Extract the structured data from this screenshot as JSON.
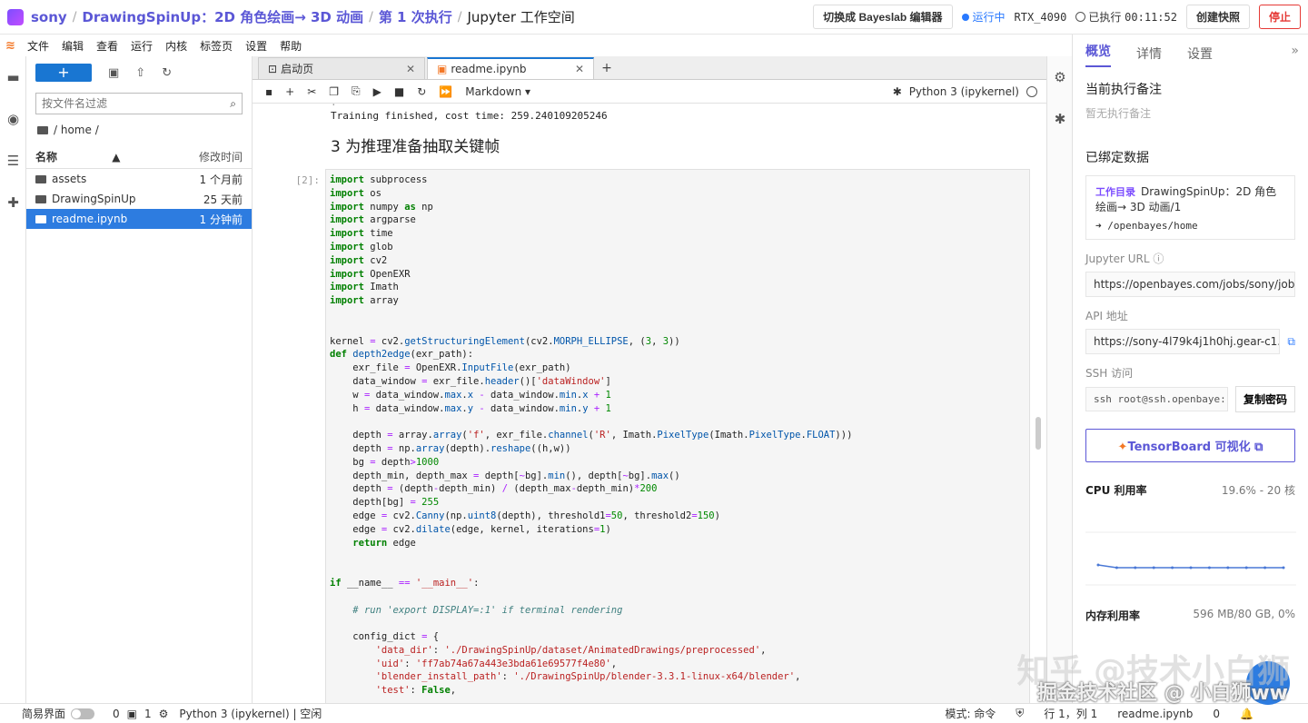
{
  "topbar": {
    "crumbs": [
      "sony",
      "DrawingSpinUp：2D 角色绘画→ 3D 动画",
      "第 1 次执行",
      "Jupyter 工作空间"
    ],
    "switch_label": "切换成 Bayeslab 编辑器",
    "status": "运行中",
    "gpu": "RTX_4090",
    "elapsed_label": "已执行",
    "elapsed_time": "00:11:52",
    "snapshot_label": "创建快照",
    "stop_label": "停止"
  },
  "menu": [
    "文件",
    "编辑",
    "查看",
    "运行",
    "内核",
    "标签页",
    "设置",
    "帮助"
  ],
  "filebrowser": {
    "filter_placeholder": "按文件名过滤",
    "path": "/ home /",
    "col_name": "名称",
    "col_modified": "修改时间",
    "files": [
      {
        "name": "assets",
        "modified": "1 个月前"
      },
      {
        "name": "DrawingSpinUp",
        "modified": "25 天前"
      },
      {
        "name": "readme.ipynb",
        "modified": "1 分钟前"
      }
    ]
  },
  "tabs": [
    {
      "label": "启动页"
    },
    {
      "label": "readme.ipynb"
    }
  ],
  "toolbar": {
    "cell_type": "Markdown",
    "kernel": "Python 3 (ipykernel)"
  },
  "notebook": {
    "output_line": "Training finished, cost time:  259.240109205246",
    "heading": "3 为推理准备抽取关键帧",
    "prompt": "[2]:"
  },
  "rightpanel": {
    "tabs": [
      "概览",
      "详情",
      "设置"
    ],
    "note_title": "当前执行备注",
    "note_empty": "暂无执行备注",
    "bound_title": "已绑定数据",
    "badge": "工作目录",
    "dataset_name": "DrawingSpinUp：2D 角色绘画→ 3D 动画/1",
    "dataset_path": "/openbayes/home",
    "jupyter_label": "Jupyter URL",
    "jupyter_url": "https://openbayes.com/jobs/sony/jobs",
    "api_label": "API 地址",
    "api_url": "https://sony-4l79k4j1h0hj.gear-c1.",
    "ssh_label": "SSH 访问",
    "ssh_cmd": "ssh root@ssh.openbaye:",
    "copy_label": "复制密码",
    "tensorboard_label": "TensorBoard 可视化",
    "cpu_label": "CPU 利用率",
    "cpu_value": "19.6% - 20 核",
    "mem_label": "内存利用率",
    "mem_value": "596 MB/80 GB, 0%",
    "cpu_series": [
      4,
      1,
      1,
      1,
      1,
      1,
      1,
      1,
      1,
      1,
      1
    ]
  },
  "statusbar": {
    "simple_label": "简易界面",
    "count1": "0",
    "count2": "1",
    "kernel_status": "Python 3 (ipykernel) | 空闲",
    "mode": "模式: 命令",
    "position": "行 1，列 1",
    "file": "readme.ipynb",
    "count3": "0"
  },
  "watermark": {
    "line1": "知乎 @技术小白狮",
    "line2": "掘金技术社区 @ 小白狮ww"
  }
}
